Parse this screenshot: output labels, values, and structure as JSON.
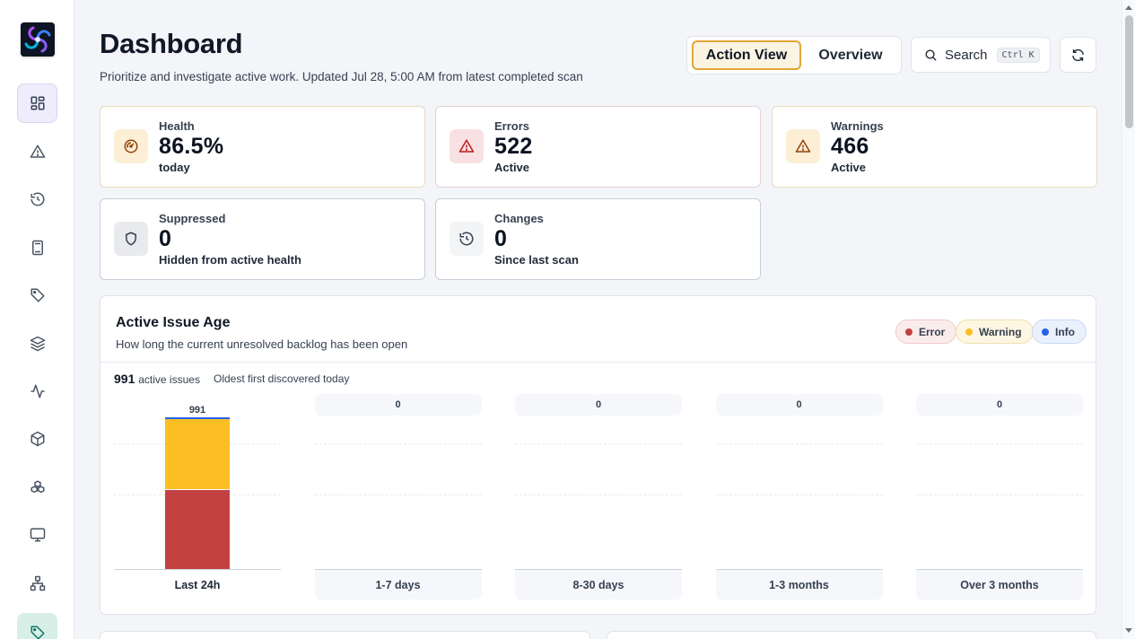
{
  "header": {
    "title": "Dashboard",
    "subtitle": "Prioritize and investigate active work. Updated Jul 28, 5:00 AM from latest completed scan"
  },
  "toolbar": {
    "view_action": "Action View",
    "view_overview": "Overview",
    "search_label": "Search",
    "search_shortcut": "Ctrl K"
  },
  "sidebar": {
    "items": [
      {
        "icon": "dashboard-grid-icon"
      },
      {
        "icon": "warning-triangle-icon"
      },
      {
        "icon": "history-icon"
      },
      {
        "icon": "calculator-icon"
      },
      {
        "icon": "tag-icon"
      },
      {
        "icon": "layers-icon"
      },
      {
        "icon": "activity-icon"
      },
      {
        "icon": "cube-icon"
      },
      {
        "icon": "boxes-icon"
      },
      {
        "icon": "monitor-icon"
      },
      {
        "icon": "network-icon"
      },
      {
        "icon": "tag-icon"
      }
    ]
  },
  "stats": {
    "health": {
      "label": "Health",
      "value": "86.5%",
      "sub": "today",
      "icon": "gauge-icon"
    },
    "errors": {
      "label": "Errors",
      "value": "522",
      "sub": "Active",
      "icon": "error-triangle-icon"
    },
    "warnings": {
      "label": "Warnings",
      "value": "466",
      "sub": "Active",
      "icon": "warning-triangle-icon"
    },
    "suppressed": {
      "label": "Suppressed",
      "value": "0",
      "sub": "Hidden from active health",
      "icon": "shield-icon"
    },
    "changes": {
      "label": "Changes",
      "value": "0",
      "sub": "Since last scan",
      "icon": "history-icon"
    }
  },
  "issue_age": {
    "title": "Active Issue Age",
    "subtitle": "How long the current unresolved backlog has been open",
    "legend": [
      {
        "label": "Error",
        "color": "#c44141"
      },
      {
        "label": "Warning",
        "color": "#fbbf24"
      },
      {
        "label": "Info",
        "color": "#2563eb"
      }
    ],
    "active_count": "991",
    "active_count_label": "active issues",
    "oldest": "Oldest first discovered today"
  },
  "chart_data": {
    "type": "bar",
    "stacked": true,
    "categories": [
      "Last 24h",
      "1-7 days",
      "8-30 days",
      "1-3 months",
      "Over 3 months"
    ],
    "totals": [
      "991",
      "0",
      "0",
      "0",
      "0"
    ],
    "series": [
      {
        "name": "Error",
        "color": "#c44141",
        "values": [
          522,
          0,
          0,
          0,
          0
        ]
      },
      {
        "name": "Warning",
        "color": "#fbbf24",
        "values": [
          466,
          0,
          0,
          0,
          0
        ]
      },
      {
        "name": "Info",
        "color": "#2563eb",
        "values": [
          3,
          0,
          0,
          0,
          0
        ]
      }
    ],
    "ylim": [
      0,
      991
    ],
    "grid": true
  },
  "colors": {
    "accent": "#e3a634",
    "error": "#c44141",
    "warning": "#fbbf24",
    "info": "#2563eb"
  }
}
